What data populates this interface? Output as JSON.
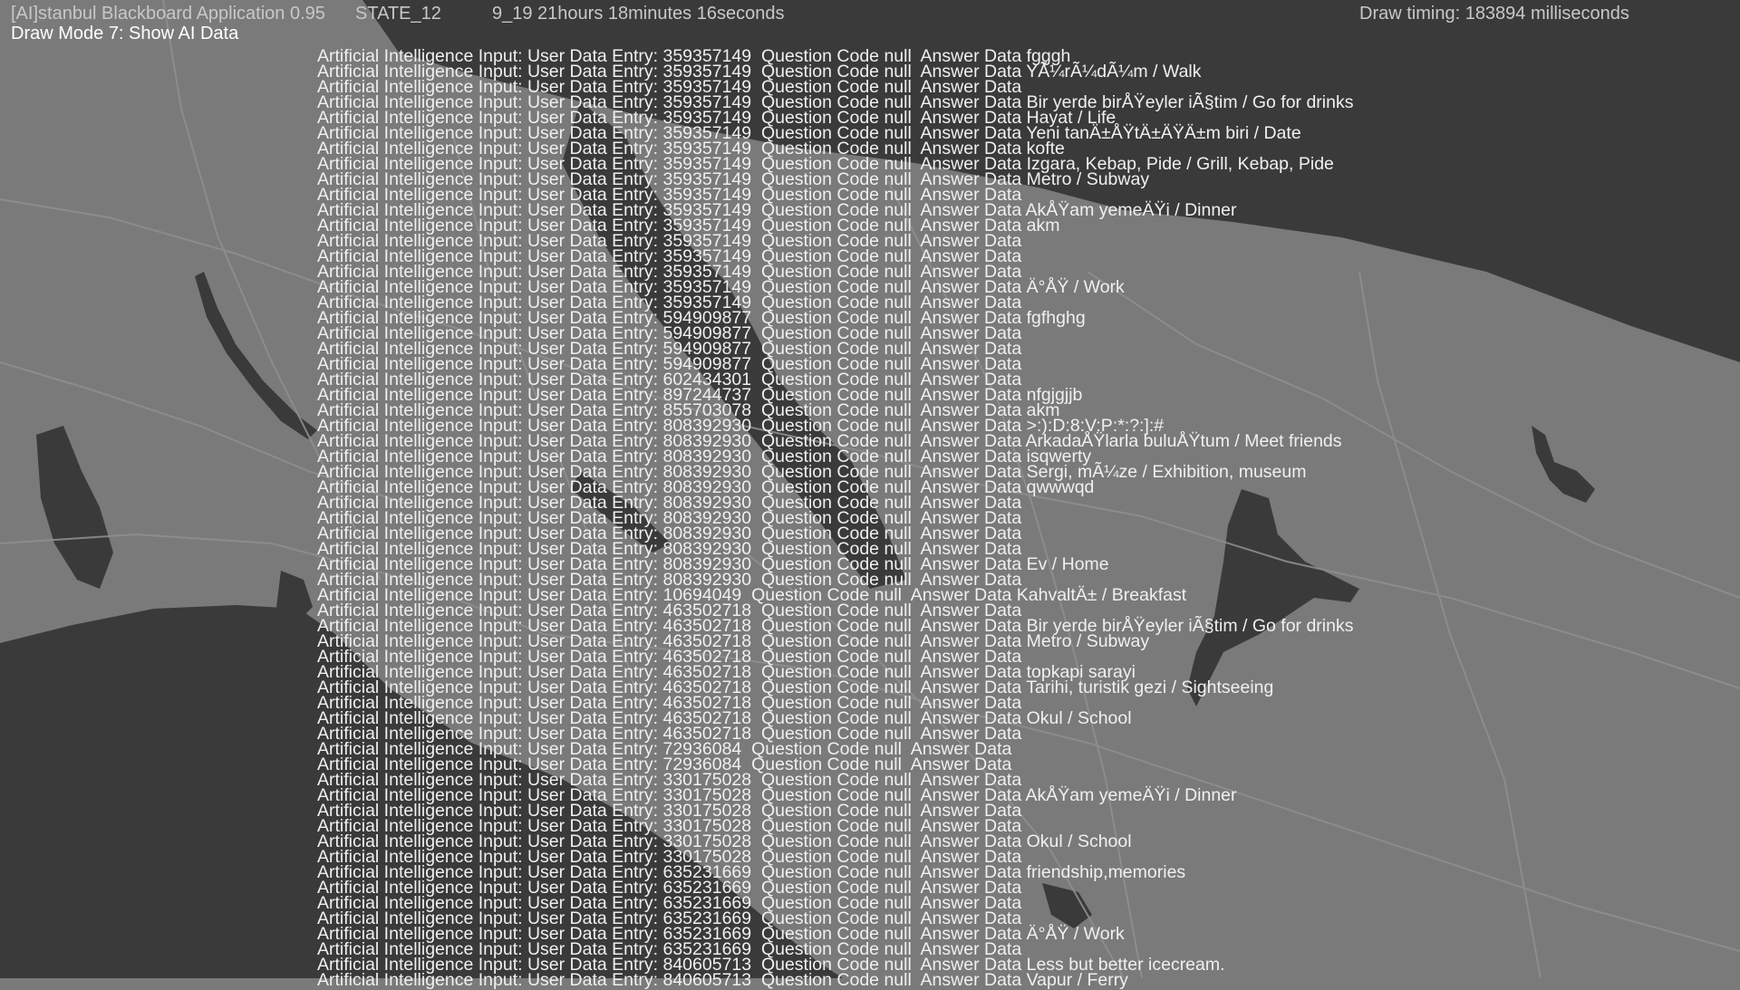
{
  "header": {
    "app_title": "[AI]stanbul Blackboard Application 0.95",
    "state": "STATE_12",
    "clock": "9_19  21hours 18minutes 16seconds",
    "draw_timing": "Draw timing: 183894 milliseconds",
    "draw_mode": "Draw Mode 7: Show AI Data"
  },
  "colors": {
    "land": "#7a7a7a",
    "water": "#3a3a3a",
    "roads": "#8c8c8c",
    "text": "#f0f0f0"
  },
  "log_lines": [
    "Artificial Intelligence Input: User Data Entry: 359357149  Question Code null  Answer Data fgggh",
    "Artificial Intelligence Input: User Data Entry: 359357149  Question Code null  Answer Data YÃ¼rÃ¼dÃ¼m / Walk",
    "Artificial Intelligence Input: User Data Entry: 359357149  Question Code null  Answer Data",
    "Artificial Intelligence Input: User Data Entry: 359357149  Question Code null  Answer Data Bir yerde birÅŸeyler iÃ§tim / Go for drinks",
    "Artificial Intelligence Input: User Data Entry: 359357149  Question Code null  Answer Data Hayat / Life",
    "Artificial Intelligence Input: User Data Entry: 359357149  Question Code null  Answer Data Yeni tanÄ±ÅŸtÄ±ÄŸÄ±m biri / Date",
    "Artificial Intelligence Input: User Data Entry: 359357149  Question Code null  Answer Data kofte",
    "Artificial Intelligence Input: User Data Entry: 359357149  Question Code null  Answer Data Izgara, Kebap, Pide / Grill, Kebap, Pide",
    "Artificial Intelligence Input: User Data Entry: 359357149  Question Code null  Answer Data Metro / Subway",
    "Artificial Intelligence Input: User Data Entry: 359357149  Question Code null  Answer Data",
    "Artificial Intelligence Input: User Data Entry: 359357149  Question Code null  Answer Data AkÅŸam yemeÄŸi / Dinner",
    "Artificial Intelligence Input: User Data Entry: 359357149  Question Code null  Answer Data akm",
    "Artificial Intelligence Input: User Data Entry: 359357149  Question Code null  Answer Data",
    "Artificial Intelligence Input: User Data Entry: 359357149  Question Code null  Answer Data",
    "Artificial Intelligence Input: User Data Entry: 359357149  Question Code null  Answer Data",
    "Artificial Intelligence Input: User Data Entry: 359357149  Question Code null  Answer Data Ä°ÅŸ / Work",
    "Artificial Intelligence Input: User Data Entry: 359357149  Question Code null  Answer Data",
    "Artificial Intelligence Input: User Data Entry: 594909877  Question Code null  Answer Data fgfhghg",
    "Artificial Intelligence Input: User Data Entry: 594909877  Question Code null  Answer Data",
    "Artificial Intelligence Input: User Data Entry: 594909877  Question Code null  Answer Data",
    "Artificial Intelligence Input: User Data Entry: 594909877  Question Code null  Answer Data",
    "Artificial Intelligence Input: User Data Entry: 602434301  Question Code null  Answer Data",
    "Artificial Intelligence Input: User Data Entry: 897244737  Question Code null  Answer Data nfgjgjjb",
    "Artificial Intelligence Input: User Data Entry: 855703078  Question Code null  Answer Data akm",
    "Artificial Intelligence Input: User Data Entry: 808392930  Question Code null  Answer Data >:):D:8:V:P:*:?:]:#",
    "Artificial Intelligence Input: User Data Entry: 808392930  Question Code null  Answer Data ArkadaÅŸlarla buluÅŸtum / Meet friends",
    "Artificial Intelligence Input: User Data Entry: 808392930  Question Code null  Answer Data isqwerty",
    "Artificial Intelligence Input: User Data Entry: 808392930  Question Code null  Answer Data Sergi, mÃ¼ze / Exhibition, museum",
    "Artificial Intelligence Input: User Data Entry: 808392930  Question Code null  Answer Data qwwwqd",
    "Artificial Intelligence Input: User Data Entry: 808392930  Question Code null  Answer Data",
    "Artificial Intelligence Input: User Data Entry: 808392930  Question Code null  Answer Data",
    "Artificial Intelligence Input: User Data Entry: 808392930  Question Code null  Answer Data",
    "Artificial Intelligence Input: User Data Entry: 808392930  Question Code null  Answer Data",
    "Artificial Intelligence Input: User Data Entry: 808392930  Question Code null  Answer Data Ev / Home",
    "Artificial Intelligence Input: User Data Entry: 808392930  Question Code null  Answer Data",
    "Artificial Intelligence Input: User Data Entry: 10694049  Question Code null  Answer Data KahvaltÄ± / Breakfast",
    "Artificial Intelligence Input: User Data Entry: 463502718  Question Code null  Answer Data",
    "Artificial Intelligence Input: User Data Entry: 463502718  Question Code null  Answer Data Bir yerde birÅŸeyler iÃ§tim / Go for drinks",
    "Artificial Intelligence Input: User Data Entry: 463502718  Question Code null  Answer Data Metro / Subway",
    "Artificial Intelligence Input: User Data Entry: 463502718  Question Code null  Answer Data",
    "Artificial Intelligence Input: User Data Entry: 463502718  Question Code null  Answer Data topkapi sarayi",
    "Artificial Intelligence Input: User Data Entry: 463502718  Question Code null  Answer Data Tarihi, turistik gezi / Sightseeing",
    "Artificial Intelligence Input: User Data Entry: 463502718  Question Code null  Answer Data",
    "Artificial Intelligence Input: User Data Entry: 463502718  Question Code null  Answer Data Okul / School",
    "Artificial Intelligence Input: User Data Entry: 463502718  Question Code null  Answer Data",
    "Artificial Intelligence Input: User Data Entry: 72936084  Question Code null  Answer Data",
    "Artificial Intelligence Input: User Data Entry: 72936084  Question Code null  Answer Data",
    "Artificial Intelligence Input: User Data Entry: 330175028  Question Code null  Answer Data",
    "Artificial Intelligence Input: User Data Entry: 330175028  Question Code null  Answer Data AkÅŸam yemeÄŸi / Dinner",
    "Artificial Intelligence Input: User Data Entry: 330175028  Question Code null  Answer Data",
    "Artificial Intelligence Input: User Data Entry: 330175028  Question Code null  Answer Data",
    "Artificial Intelligence Input: User Data Entry: 330175028  Question Code null  Answer Data Okul / School",
    "Artificial Intelligence Input: User Data Entry: 330175028  Question Code null  Answer Data",
    "Artificial Intelligence Input: User Data Entry: 635231669  Question Code null  Answer Data friendship,memories",
    "Artificial Intelligence Input: User Data Entry: 635231669  Question Code null  Answer Data",
    "Artificial Intelligence Input: User Data Entry: 635231669  Question Code null  Answer Data",
    "Artificial Intelligence Input: User Data Entry: 635231669  Question Code null  Answer Data",
    "Artificial Intelligence Input: User Data Entry: 635231669  Question Code null  Answer Data Ä°ÅŸ / Work",
    "Artificial Intelligence Input: User Data Entry: 635231669  Question Code null  Answer Data",
    "Artificial Intelligence Input: User Data Entry: 840605713  Question Code null  Answer Data Less but better icecream.",
    "Artificial Intelligence Input: User Data Entry: 840605713  Question Code null  Answer Data Vapur / Ferry"
  ]
}
